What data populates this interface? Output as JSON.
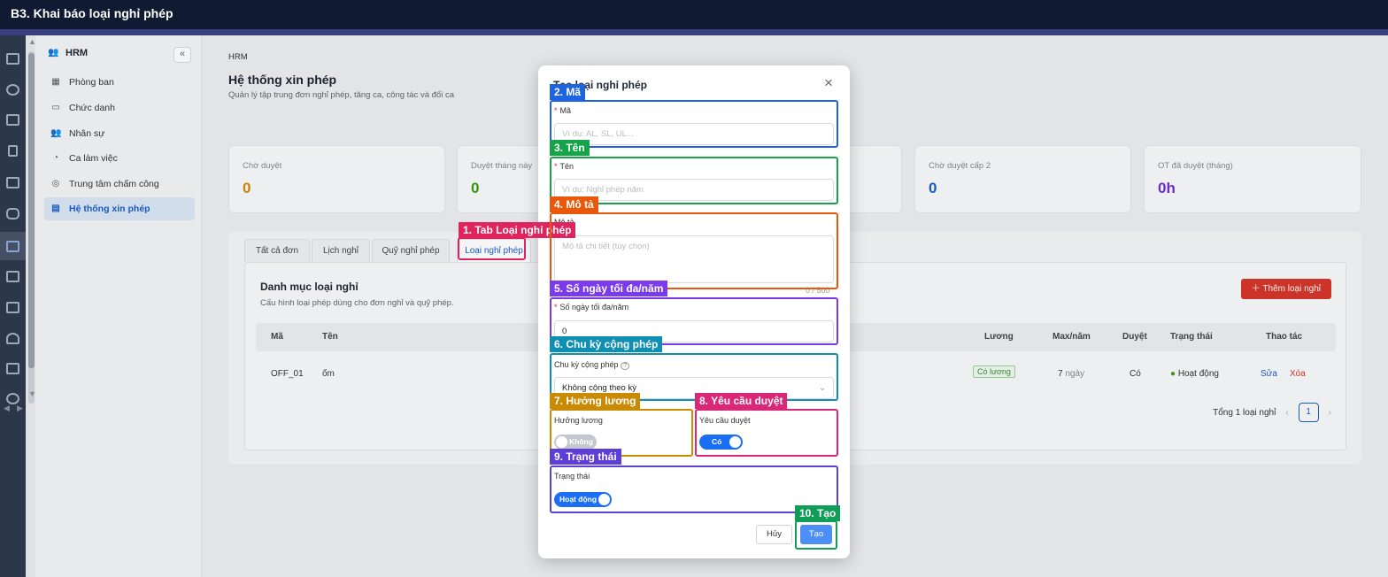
{
  "header": {
    "title": "B3. Khai báo loại nghỉ phép"
  },
  "rail": {
    "icons": [
      "building-icon",
      "beach-icon",
      "chat-icon",
      "calculator-icon",
      "briefcase-icon",
      "car-icon",
      "users-icon",
      "office-icon",
      "store-icon",
      "person-icon",
      "chart-icon",
      "settings-icon"
    ]
  },
  "sidebar": {
    "title": "HRM",
    "collapse": "«",
    "items": [
      {
        "label": "Phòng ban",
        "icon": "building-icon"
      },
      {
        "label": "Chức danh",
        "icon": "id-card-icon"
      },
      {
        "label": "Nhân sự",
        "icon": "users-icon"
      },
      {
        "label": "Ca làm việc",
        "icon": "clock-icon"
      },
      {
        "label": "Trung tâm chấm công",
        "icon": "fingerprint-icon"
      },
      {
        "label": "Hệ thống xin phép",
        "icon": "calendar-icon"
      }
    ]
  },
  "page": {
    "breadcrumb": "HRM",
    "title": "Hệ thống xin phép",
    "subtitle": "Quản lý tập trung đơn nghỉ phép, tăng ca, công tác và đổi ca"
  },
  "stats": [
    {
      "label": "Chờ duyệt",
      "value": "0",
      "color": "#d48806"
    },
    {
      "label": "Duyệt tháng này",
      "value": "0",
      "color": "#389e0d"
    },
    {
      "label": "Chờ duyệt cấp 2",
      "value": "0",
      "color": "#1b5fc9"
    },
    {
      "label": "OT đã duyệt (tháng)",
      "value": "0h",
      "color": "#722ed1"
    }
  ],
  "tabs": [
    "Tất cả đơn",
    "Lịch nghỉ",
    "Quỹ nghỉ phép",
    "Loại nghỉ phép"
  ],
  "section": {
    "title": "Danh mục loại nghỉ",
    "subtitle": "Cấu hình loại phép dùng cho đơn nghỉ và quỹ phép.",
    "add_button": "Thêm loại nghỉ"
  },
  "table": {
    "columns": [
      "Mã",
      "Tên",
      "Lương",
      "Max/năm",
      "Duyệt",
      "Trạng thái",
      "Thao tác"
    ],
    "row": {
      "code": "OFF_01",
      "name": "ốm",
      "salary": "Có lương",
      "max_num": "7",
      "max_unit": "ngày",
      "approve": "Có",
      "status": "Hoạt động",
      "edit": "Sửa",
      "delete": "Xóa"
    },
    "total": "Tổng 1 loại nghỉ",
    "page": "1",
    "prev": "‹",
    "next": "›"
  },
  "modal": {
    "title": "Tạo loại nghỉ phép",
    "close": "×",
    "code_label": "Mã",
    "code_placeholder": "Ví dụ: AL, SL, UL...",
    "name_label": "Tên",
    "name_placeholder": "Ví dụ: Nghỉ phép năm",
    "desc_label": "Mô tả",
    "desc_placeholder": "Mô tả chi tiết (tùy chọn)",
    "desc_count": "0 / 500",
    "max_label": "Số ngày tối đa/năm",
    "max_value": "0",
    "cycle_label": "Chu kỳ cộng phép",
    "cycle_value": "Không cộng theo kỳ",
    "salary_label": "Hưởng lương",
    "salary_toggle": "Không",
    "approval_label": "Yêu cầu duyệt",
    "approval_toggle": "Có",
    "status_label": "Trạng thái",
    "status_toggle": "Hoạt động",
    "cancel": "Hủy",
    "create": "Tạo"
  },
  "annotations": [
    {
      "text": "1. Tab Loại nghỉ phép",
      "color": "#e0245e"
    },
    {
      "text": "2. Mã",
      "color": "#1e63e0"
    },
    {
      "text": "3. Tên",
      "color": "#16a34a"
    },
    {
      "text": "4. Mô tả",
      "color": "#ea580c"
    },
    {
      "text": "5. Số ngày tối đa/năm",
      "color": "#7c3aed"
    },
    {
      "text": "6. Chu kỳ cộng phép",
      "color": "#0e8fb3"
    },
    {
      "text": "7. Hưởng lương",
      "color": "#ca8a04"
    },
    {
      "text": "8. Yêu cầu duyệt",
      "color": "#db2777"
    },
    {
      "text": "9. Trạng thái",
      "color": "#5b3fd6"
    },
    {
      "text": "10. Tạo",
      "color": "#0f9d58"
    }
  ]
}
